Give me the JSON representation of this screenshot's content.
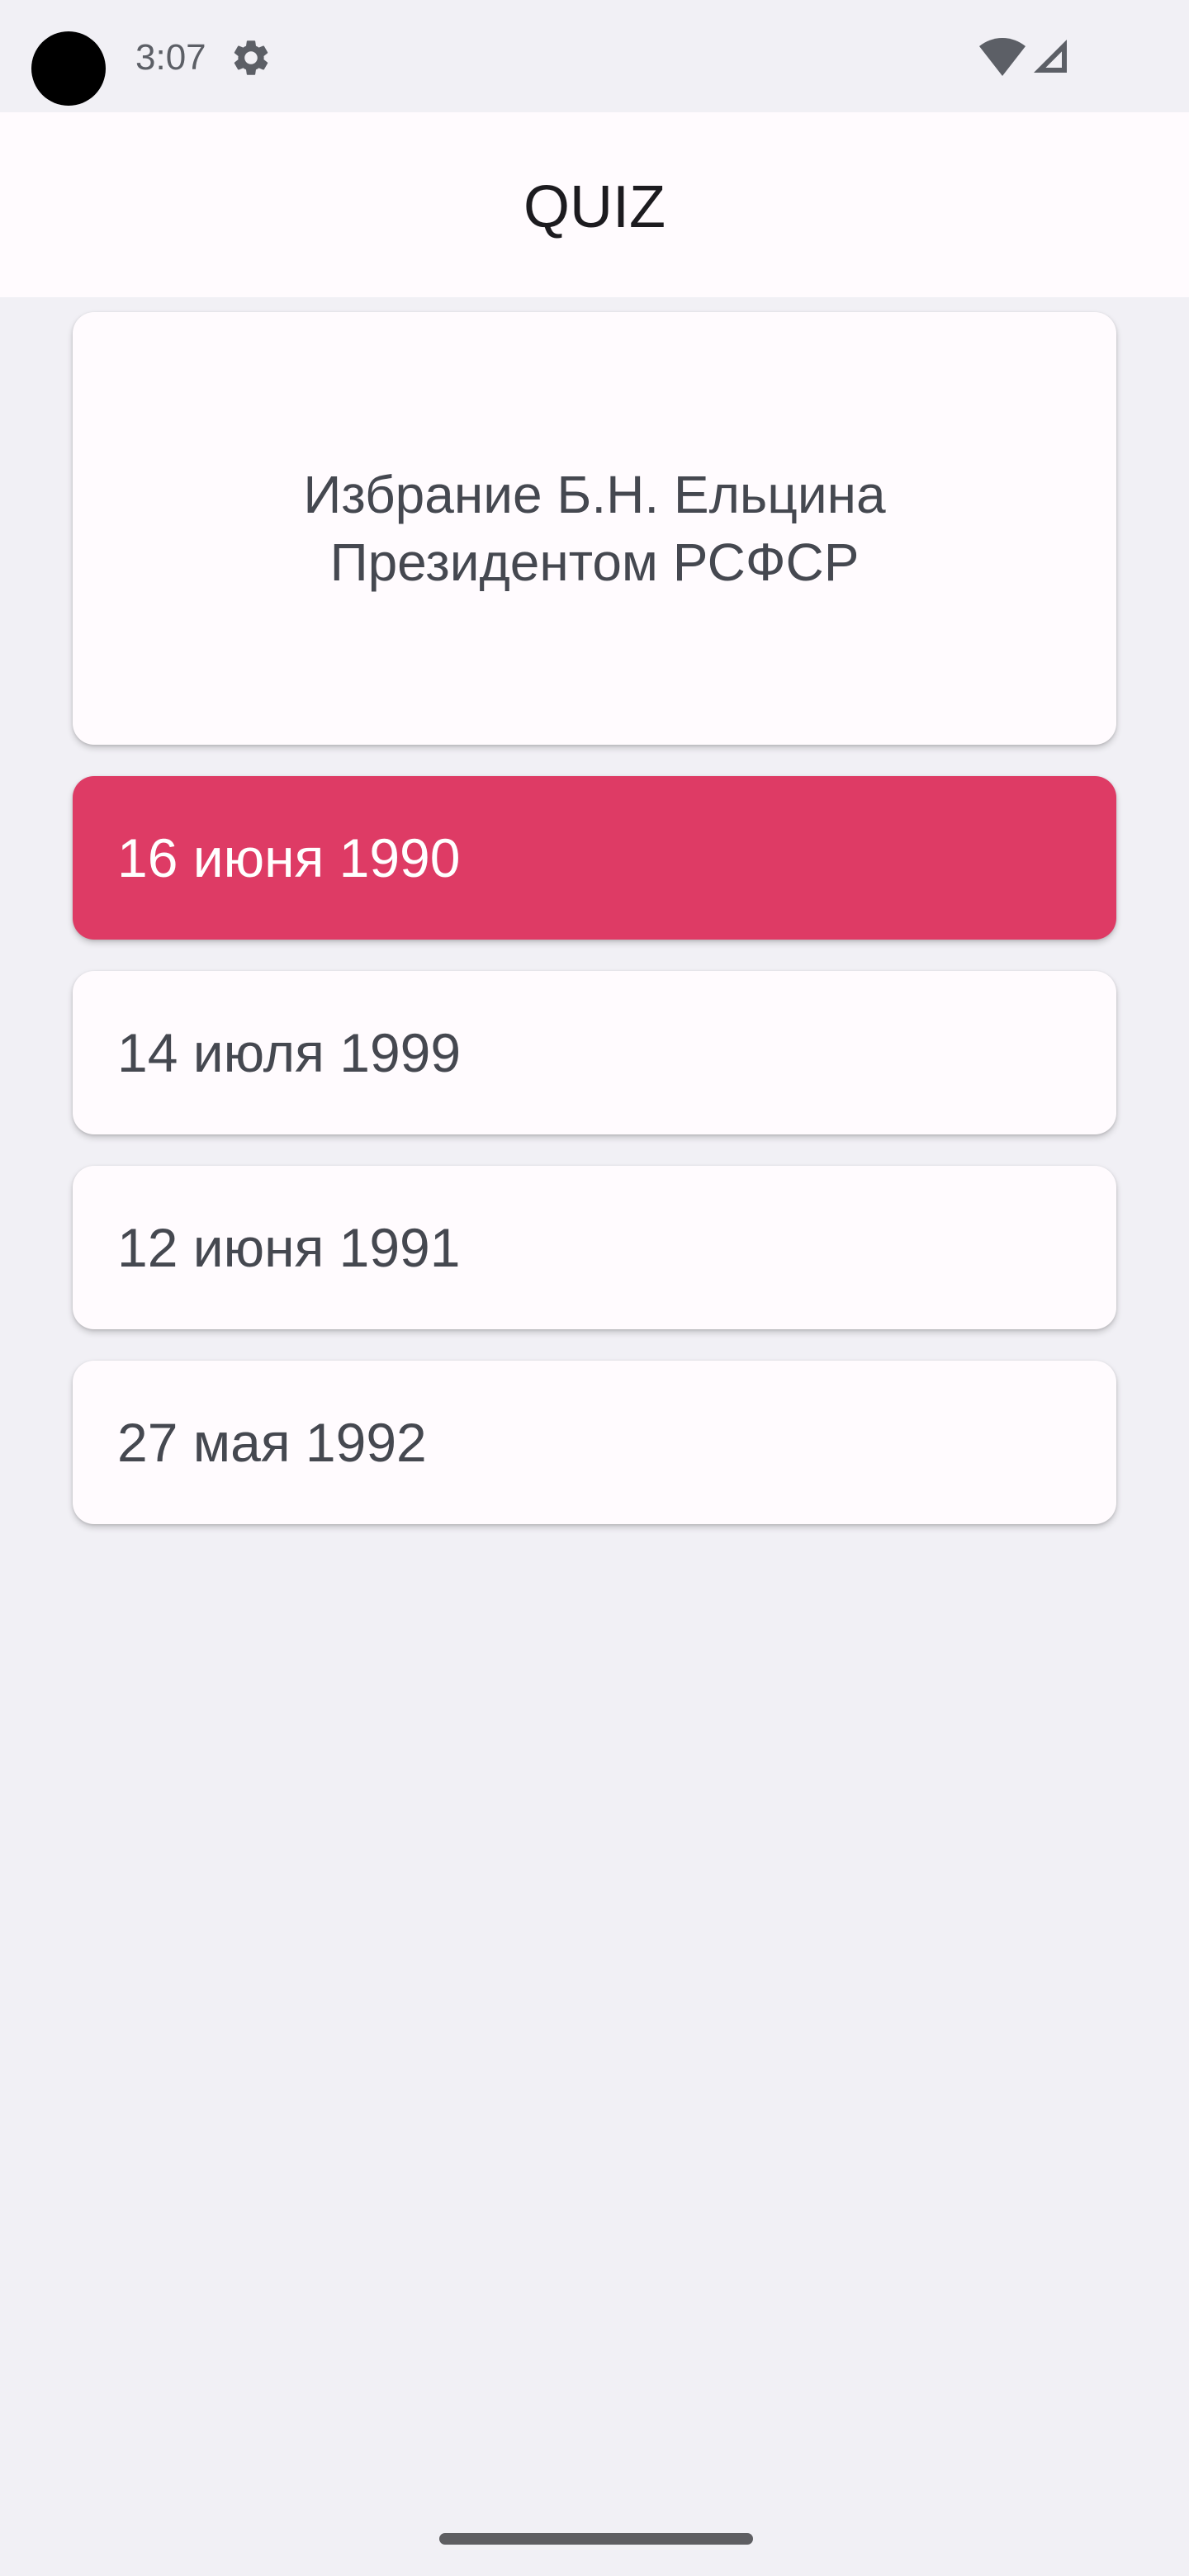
{
  "status_bar": {
    "time": "3:07",
    "icons": [
      "gear-icon",
      "wifi-icon",
      "signal-icon"
    ]
  },
  "app_bar": {
    "title": "QUIZ"
  },
  "question": {
    "text": "Избрание Б.Н. Ельцина Президентом РСФСР"
  },
  "answers": [
    {
      "label": "16 июня 1990",
      "selected": true
    },
    {
      "label": "14 июля 1999",
      "selected": false
    },
    {
      "label": "12 июня 1991",
      "selected": false
    },
    {
      "label": "27 мая 1992",
      "selected": false
    }
  ],
  "colors": {
    "background": "#f1f0f5",
    "surface": "#fffbfe",
    "selected_accent": "#de3b65",
    "text": "#454850"
  }
}
